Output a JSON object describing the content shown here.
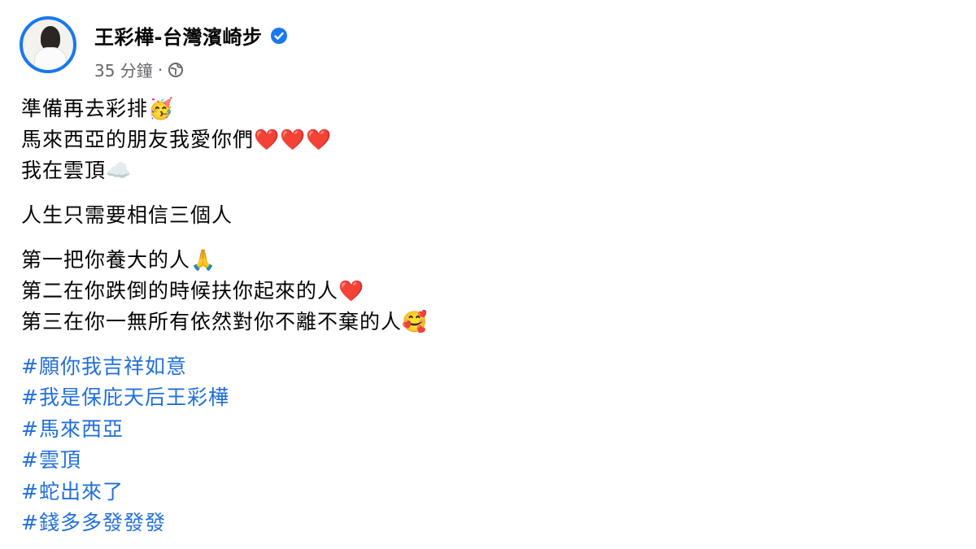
{
  "post": {
    "author": "王彩樺-台灣濱崎步",
    "time": "35 分鐘",
    "separator": "·",
    "paragraphs": [
      [
        "準備再去彩排🥳",
        "馬來西亞的朋友我愛你們❤️❤️❤️",
        "我在雲頂☁️"
      ],
      [
        "人生只需要相信三個人"
      ],
      [
        "第一把你養大的人🙏",
        "第二在你跌倒的時候扶你起來的人❤️",
        "第三在你一無所有依然對你不離不棄的人🥰"
      ]
    ],
    "hashtags": [
      "#願你我吉祥如意",
      "#我是保庇天后王彩樺",
      "#馬來西亞",
      "#雲頂",
      "#蛇出來了",
      "#錢多多發發發"
    ]
  },
  "icons": {
    "verified": "verified-badge-icon",
    "privacy": "globe-icon"
  },
  "colors": {
    "accent": "#1877f2",
    "hashtag": "#216fdb",
    "muted": "#65676b"
  }
}
